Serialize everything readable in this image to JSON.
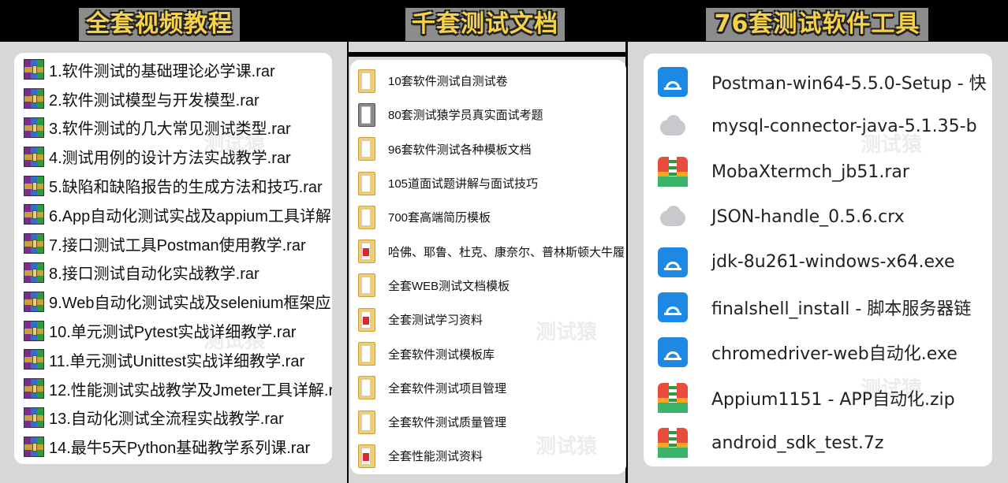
{
  "headings": {
    "left": "全套视频教程",
    "middle": "千套测试文档",
    "right": "76套测试软件工具"
  },
  "colors": {
    "heading_text": "#f5d24a",
    "heading_bg": "#8c8c8c",
    "panel_bg": "#d7d7d7"
  },
  "watermark": "测试猿",
  "left_items": [
    {
      "label": "1.软件测试的基础理论必学课.rar",
      "icon": "rar-archive-icon"
    },
    {
      "label": "2.软件测试模型与开发模型.rar",
      "icon": "rar-archive-icon"
    },
    {
      "label": "3.软件测试的几大常见测试类型.rar",
      "icon": "rar-archive-icon"
    },
    {
      "label": "4.测试用例的设计方法实战教学.rar",
      "icon": "rar-archive-icon"
    },
    {
      "label": "5.缺陷和缺陷报告的生成方法和技巧.rar",
      "icon": "rar-archive-icon"
    },
    {
      "label": "6.App自动化测试实战及appium工具详解",
      "icon": "rar-archive-icon"
    },
    {
      "label": "7.接口测试工具Postman使用教学.rar",
      "icon": "rar-archive-icon"
    },
    {
      "label": "8.接口测试自动化实战教学.rar",
      "icon": "rar-archive-icon"
    },
    {
      "label": "9.Web自动化测试实战及selenium框架应",
      "icon": "rar-archive-icon"
    },
    {
      "label": "10.单元测试Pytest实战详细教学.rar",
      "icon": "rar-archive-icon"
    },
    {
      "label": "11.单元测试Unittest实战详细教学.rar",
      "icon": "rar-archive-icon"
    },
    {
      "label": "12.性能测试实战教学及Jmeter工具详解.r",
      "icon": "rar-archive-icon"
    },
    {
      "label": "13.自动化测试全流程实战教学.rar",
      "icon": "rar-archive-icon"
    },
    {
      "label": "14.最牛5天Python基础教学系列课.rar",
      "icon": "rar-archive-icon"
    }
  ],
  "middle_items": [
    {
      "label": "10套软件测试自测试卷",
      "icon": "folder-icon"
    },
    {
      "label": "80套测试猿学员真实面试考题",
      "icon": "folder-icon"
    },
    {
      "label": "96套软件测试各种模板文档",
      "icon": "folder-icon"
    },
    {
      "label": "105道面试题讲解与面试技巧",
      "icon": "folder-icon"
    },
    {
      "label": "700套高端简历模板",
      "icon": "folder-icon"
    },
    {
      "label": "哈佛、耶鲁、杜克、康奈尔、普林斯顿大牛履",
      "icon": "folder-icon"
    },
    {
      "label": "全套WEB测试文档模板",
      "icon": "folder-icon"
    },
    {
      "label": "全套测试学习资料",
      "icon": "folder-icon"
    },
    {
      "label": "全套软件测试模板库",
      "icon": "folder-icon"
    },
    {
      "label": "全套软件测试项目管理",
      "icon": "folder-icon"
    },
    {
      "label": "全套软件测试质量管理",
      "icon": "folder-icon"
    },
    {
      "label": "全套性能测试资料",
      "icon": "folder-icon"
    }
  ],
  "right_items": [
    {
      "label": "Postman-win64-5.5.0-Setup - 快",
      "icon": "installer-icon"
    },
    {
      "label": "mysql-connector-java-5.1.35-b",
      "icon": "cloud-icon"
    },
    {
      "label": "MobaXtermch_jb51.rar",
      "icon": "archive-icon"
    },
    {
      "label": "JSON-handle_0.5.6.crx",
      "icon": "cloud-icon"
    },
    {
      "label": "jdk-8u261-windows-x64.exe",
      "icon": "installer-icon"
    },
    {
      "label": "finalshell_install - 脚本服务器链",
      "icon": "installer-icon"
    },
    {
      "label": "chromedriver-web自动化.exe",
      "icon": "installer-icon"
    },
    {
      "label": "Appium1151 - APP自动化.zip",
      "icon": "archive-icon"
    },
    {
      "label": "android_sdk_test.7z",
      "icon": "archive-icon"
    }
  ]
}
